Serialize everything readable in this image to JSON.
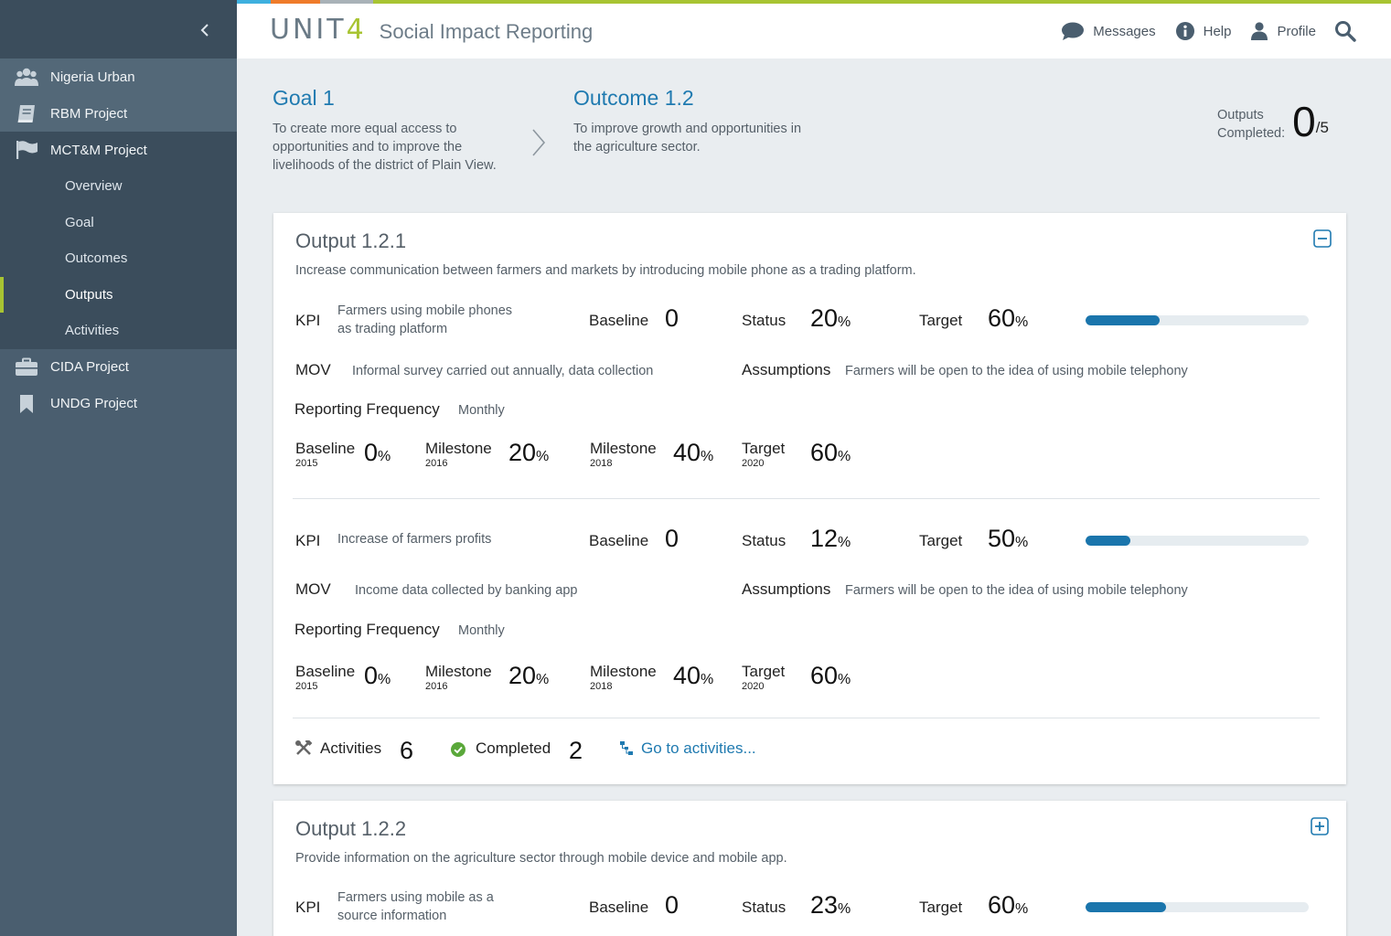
{
  "header": {
    "brand_main": "UNIT",
    "brand_accent": "4",
    "app_name": "Social Impact Reporting",
    "messages_label": "Messages",
    "help_label": "Help",
    "profile_label": "Profile"
  },
  "sidebar": {
    "items": [
      {
        "label": "Nigeria Urban",
        "icon": "group-icon"
      },
      {
        "label": "RBM Project",
        "icon": "book-icon"
      },
      {
        "label": "MCT&M Project",
        "icon": "flag-icon"
      },
      {
        "label": "CIDA Project",
        "icon": "briefcase-icon"
      },
      {
        "label": "UNDG Project",
        "icon": "bookmark-icon"
      }
    ],
    "subitems": [
      "Overview",
      "Goal",
      "Outcomes",
      "Outputs",
      "Activities"
    ],
    "active_subitem": "Outputs"
  },
  "breadcrumb": {
    "goal_title": "Goal 1",
    "goal_desc": "To create more equal access to opportunities and to improve the livelihoods of the district of Plain View.",
    "outcome_title": "Outcome 1.2",
    "outcome_desc": "To improve growth and opportunities in the agriculture sector."
  },
  "summary": {
    "label_line1": "Outputs",
    "label_line2": "Completed:",
    "completed": "0",
    "total": "/5"
  },
  "labels": {
    "kpi": "KPI",
    "baseline": "Baseline",
    "status": "Status",
    "target": "Target",
    "mov": "MOV",
    "assumptions": "Assumptions",
    "reporting_frequency": "Reporting Frequency",
    "milestone": "Milestone",
    "pct": "%",
    "activities": "Activities",
    "completed": "Completed",
    "go_to_activities": "Go to activities..."
  },
  "outputs": [
    {
      "title": "Output 1.2.1",
      "description": "Increase communication between farmers and markets by introducing mobile phone as a trading platform.",
      "expanded": true,
      "kpis": [
        {
          "name": "Farmers using mobile phones as trading platform",
          "baseline": "0",
          "status": "20",
          "target": "60",
          "progress": 0.33,
          "mov": "Informal survey carried out annually, data collection",
          "assumptions": "Farmers will be open to the idea of using mobile telephony",
          "frequency": "Monthly",
          "timeline": [
            {
              "label": "Baseline",
              "year": "2015",
              "value": "0"
            },
            {
              "label": "Milestone",
              "year": "2016",
              "value": "20"
            },
            {
              "label": "Milestone",
              "year": "2018",
              "value": "40"
            },
            {
              "label": "Target",
              "year": "2020",
              "value": "60"
            }
          ]
        },
        {
          "name": "Increase of farmers profits",
          "baseline": "0",
          "status": "12",
          "target": "50",
          "progress": 0.2,
          "mov": "Income data collected by banking app",
          "assumptions": "Farmers will be open to the idea of using mobile telephony",
          "frequency": "Monthly",
          "timeline": [
            {
              "label": "Baseline",
              "year": "2015",
              "value": "0"
            },
            {
              "label": "Milestone",
              "year": "2016",
              "value": "20"
            },
            {
              "label": "Milestone",
              "year": "2018",
              "value": "40"
            },
            {
              "label": "Target",
              "year": "2020",
              "value": "60"
            }
          ]
        }
      ],
      "activities_count": "6",
      "completed_count": "2"
    },
    {
      "title": "Output 1.2.2",
      "description": "Provide information on the agriculture sector through mobile device and mobile app.",
      "expanded": false,
      "kpis": [
        {
          "name": "Farmers using mobile as a source information",
          "baseline": "0",
          "status": "23",
          "target": "60",
          "progress": 0.36
        }
      ]
    }
  ],
  "colors": {
    "accent_green": "#a8c432",
    "accent_blue": "#1f7ab0",
    "progress_fill": "#1a75ac",
    "sidebar_bg": "#4a5e6f",
    "completed_check": "#5aa83a"
  }
}
